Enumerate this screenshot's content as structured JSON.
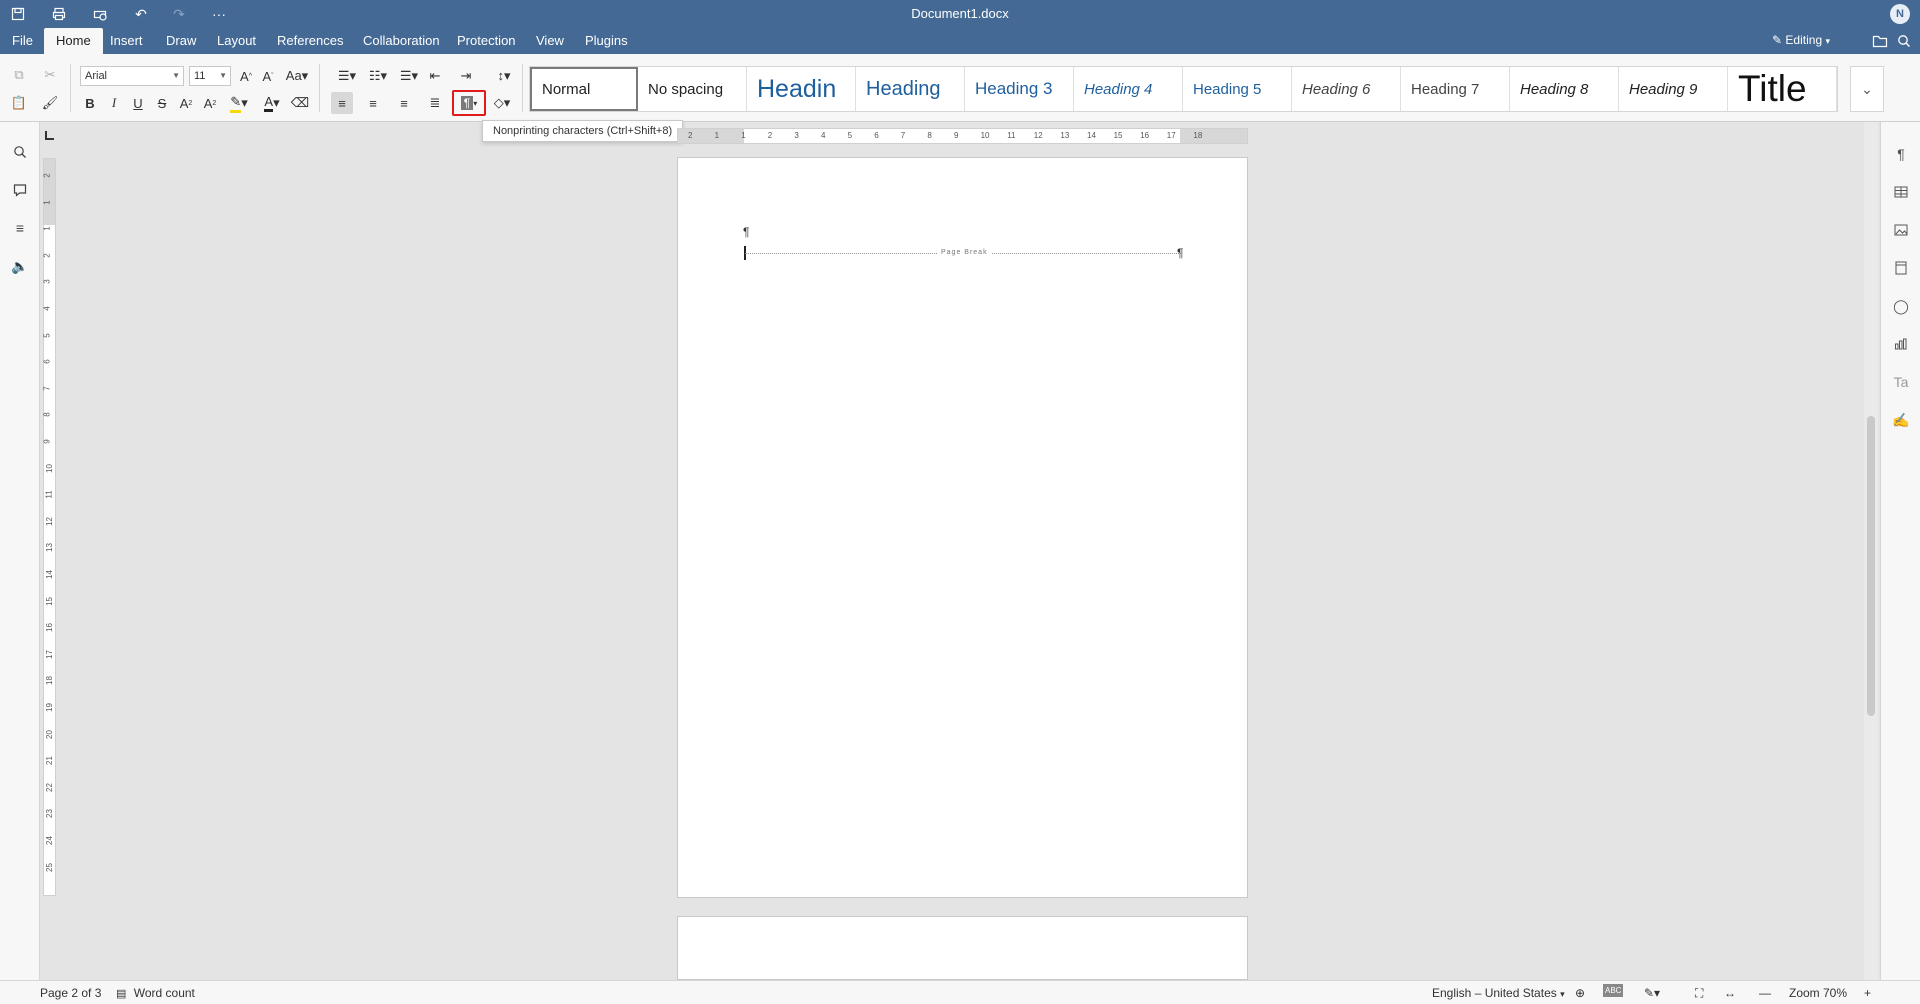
{
  "titlebar": {
    "doc_title": "Document1.docx",
    "avatar": "N",
    "quick_icons": [
      "save-icon",
      "print-icon",
      "quick-print-icon",
      "undo-icon",
      "redo-icon",
      "more-icon"
    ]
  },
  "menu": {
    "tabs": [
      "File",
      "Home",
      "Insert",
      "Draw",
      "Layout",
      "References",
      "Collaboration",
      "Protection",
      "View",
      "Plugins"
    ],
    "active": "Home",
    "editing_label": "Editing"
  },
  "toolbar": {
    "font_name": "Arial",
    "font_size": "11"
  },
  "styles": {
    "items": [
      "Normal",
      "No spacing",
      "Headin",
      "Heading",
      "Heading 3",
      "Heading 4",
      "Heading 5",
      "Heading 6",
      "Heading 7",
      "Heading 8",
      "Heading 9",
      "Title"
    ],
    "selected": "Normal"
  },
  "tooltip": "Nonprinting characters (Ctrl+Shift+8)",
  "ruler": {
    "h_ticks": [
      "2",
      "1",
      "1",
      "2",
      "3",
      "4",
      "5",
      "6",
      "7",
      "8",
      "9",
      "10",
      "11",
      "12",
      "13",
      "14",
      "15",
      "16",
      "17",
      "18"
    ],
    "v_ticks": [
      "2",
      "1",
      "1",
      "2",
      "3",
      "4",
      "5",
      "6",
      "7",
      "8",
      "9",
      "10",
      "11",
      "12",
      "13",
      "14",
      "15",
      "16",
      "17",
      "18",
      "19",
      "20",
      "21",
      "22",
      "23",
      "24",
      "25"
    ]
  },
  "document": {
    "pilcrow": "¶",
    "page_break_label": "Page Break"
  },
  "status": {
    "page": "Page 2 of 3",
    "word_count": "Word count",
    "language": "English – United States",
    "zoom": "Zoom 70%"
  },
  "colors": {
    "header_bg": "#446995",
    "highlight_border": "#e01b1b"
  }
}
